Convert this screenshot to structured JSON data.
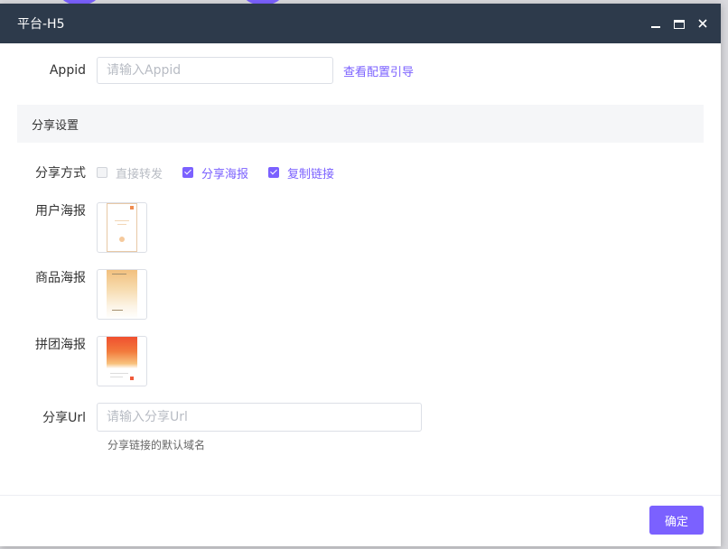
{
  "dialog": {
    "title": "平台-H5",
    "controls": {
      "minimize": "minimize-icon",
      "maximize": "maximize-icon",
      "close": "close-icon"
    }
  },
  "appid": {
    "label": "Appid",
    "value": "",
    "placeholder": "请输入Appid",
    "guide_link": "查看配置引导"
  },
  "share_section": {
    "title": "分享设置",
    "method": {
      "label": "分享方式",
      "options": [
        {
          "label": "直接转发",
          "checked": false,
          "disabled": true
        },
        {
          "label": "分享海报",
          "checked": true,
          "disabled": false
        },
        {
          "label": "复制链接",
          "checked": true,
          "disabled": false
        }
      ]
    },
    "posters": [
      {
        "label": "用户海报"
      },
      {
        "label": "商品海报"
      },
      {
        "label": "拼团海报"
      }
    ],
    "url": {
      "label": "分享Url",
      "value": "",
      "placeholder": "请输入分享Url",
      "hint": "分享链接的默认域名"
    }
  },
  "footer": {
    "confirm_label": "确定"
  },
  "colors": {
    "accent": "#7b61ff",
    "titlebar": "#2d3a4b"
  }
}
